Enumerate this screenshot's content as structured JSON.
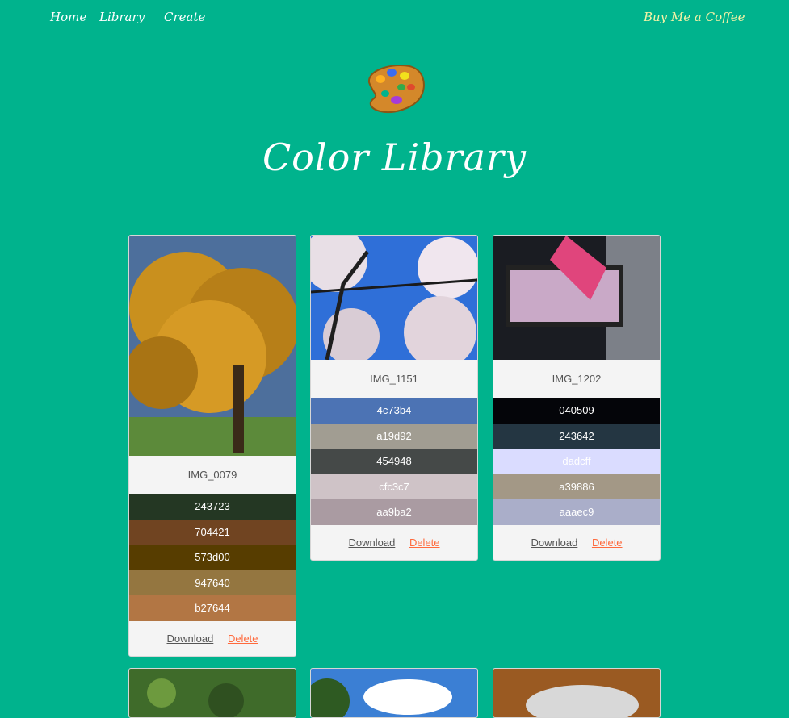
{
  "nav": {
    "home": "Home",
    "library": "Library",
    "create": "Create",
    "coffee": "Buy Me a Coffee"
  },
  "header": {
    "title": "Color Library",
    "icon": "artist-palette-icon"
  },
  "cards": [
    {
      "name": "IMG_0079",
      "colors": [
        "243723",
        "704421",
        "573d00",
        "947640",
        "b27644"
      ],
      "download": "Download",
      "delete": "Delete"
    },
    {
      "name": "IMG_1151",
      "colors": [
        "4c73b4",
        "a19d92",
        "454948",
        "cfc3c7",
        "aa9ba2"
      ],
      "download": "Download",
      "delete": "Delete"
    },
    {
      "name": "IMG_1202",
      "colors": [
        "040509",
        "243642",
        "dadcff",
        "a39886",
        "aaaec9"
      ],
      "download": "Download",
      "delete": "Delete"
    }
  ],
  "colors": {
    "background": "#00b38d",
    "delete_link": "#ff6a3d",
    "coffee_link": "#f4f2a6"
  }
}
